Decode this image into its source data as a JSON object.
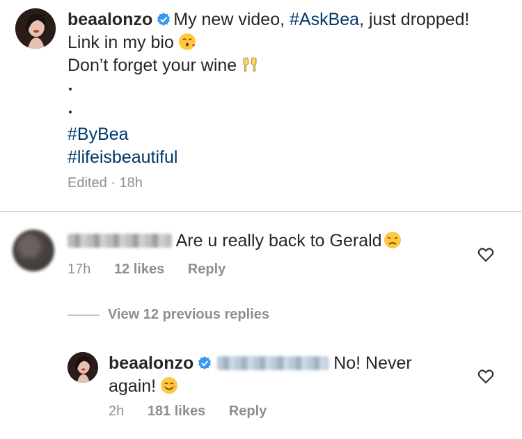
{
  "caption": {
    "username": "beaalonzo",
    "text_line1": "My new video, ",
    "hashtag_askbea": "#AskBea",
    "text_line1_end": ", just dropped!",
    "text_line2": "Link in my bio",
    "emoji_line2": "kissing-face-emoji",
    "text_line3": "Don’t forget your wine",
    "emoji_line3": "clinking-glasses-emoji",
    "dots": [
      ".",
      "."
    ],
    "hashtags": [
      "#ByBea",
      "#lifeisbeautiful"
    ],
    "meta": "Edited · 18h"
  },
  "comment1": {
    "username_blurred": true,
    "text": "Are u really back to Gerald",
    "emoji": "disappointed-face-emoji",
    "time": "17h",
    "likes": "12 likes",
    "reply_label": "Reply"
  },
  "view_replies_label": "View 12 previous replies",
  "reply1": {
    "username": "beaalonzo",
    "mention_blurred": true,
    "text_part1": " No! Never",
    "text_part2": "again!",
    "emoji": "smiling-face-emoji",
    "time": "2h",
    "likes": "181 likes",
    "reply_label": "Reply"
  },
  "colors": {
    "text": "#262626",
    "secondary": "#8e8e8e",
    "hashtag": "#00376b",
    "verified": "#3897f0",
    "divider": "#dbdbdb"
  }
}
